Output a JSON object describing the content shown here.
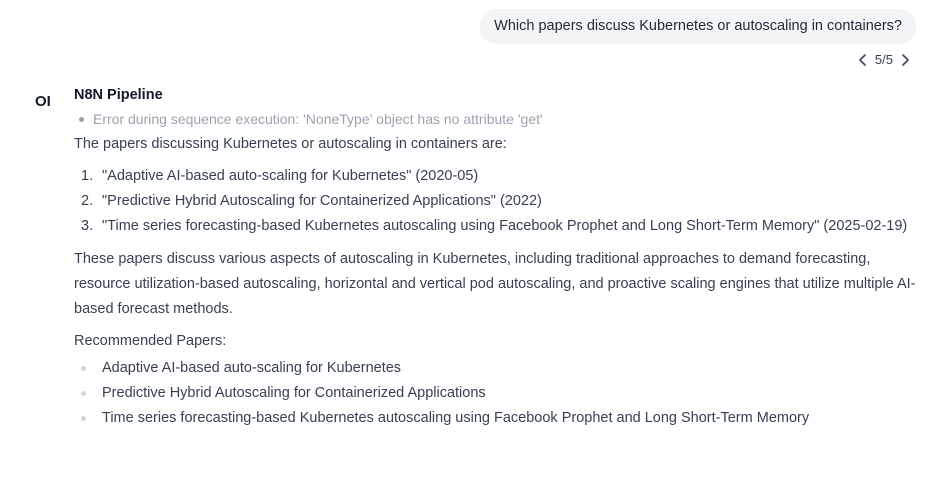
{
  "user_message": "Which papers discuss Kubernetes or autoscaling in containers?",
  "pager": {
    "current": "5",
    "separator": "/",
    "total": "5"
  },
  "assistant": {
    "avatar": "OI",
    "name": "N8N Pipeline",
    "status": "Error during sequence execution: 'NoneType' object has no attribute 'get'",
    "intro": "The papers discussing Kubernetes or autoscaling in containers are:",
    "numbered": [
      {
        "num": "1.",
        "text": "\"Adaptive AI-based auto-scaling for Kubernetes\" (2020-05)"
      },
      {
        "num": "2.",
        "text": "\"Predictive Hybrid Autoscaling for Containerized Applications\" (2022)"
      },
      {
        "num": "3.",
        "text": "\"Time series forecasting-based Kubernetes autoscaling using Facebook Prophet and Long Short-Term Memory\" (2025-02-19)"
      }
    ],
    "summary": "These papers discuss various aspects of autoscaling in Kubernetes, including traditional approaches to demand forecasting, resource utilization-based autoscaling, horizontal and vertical pod autoscaling, and proactive scaling engines that utilize multiple AI-based forecast methods.",
    "recommended_label": "Recommended Papers:",
    "recommended": [
      "Adaptive AI-based auto-scaling for Kubernetes",
      "Predictive Hybrid Autoscaling for Containerized Applications",
      "Time series forecasting-based Kubernetes autoscaling using Facebook Prophet and Long Short-Term Memory"
    ]
  },
  "icons": {
    "prev": "chevron-left-icon",
    "next": "chevron-right-icon"
  }
}
